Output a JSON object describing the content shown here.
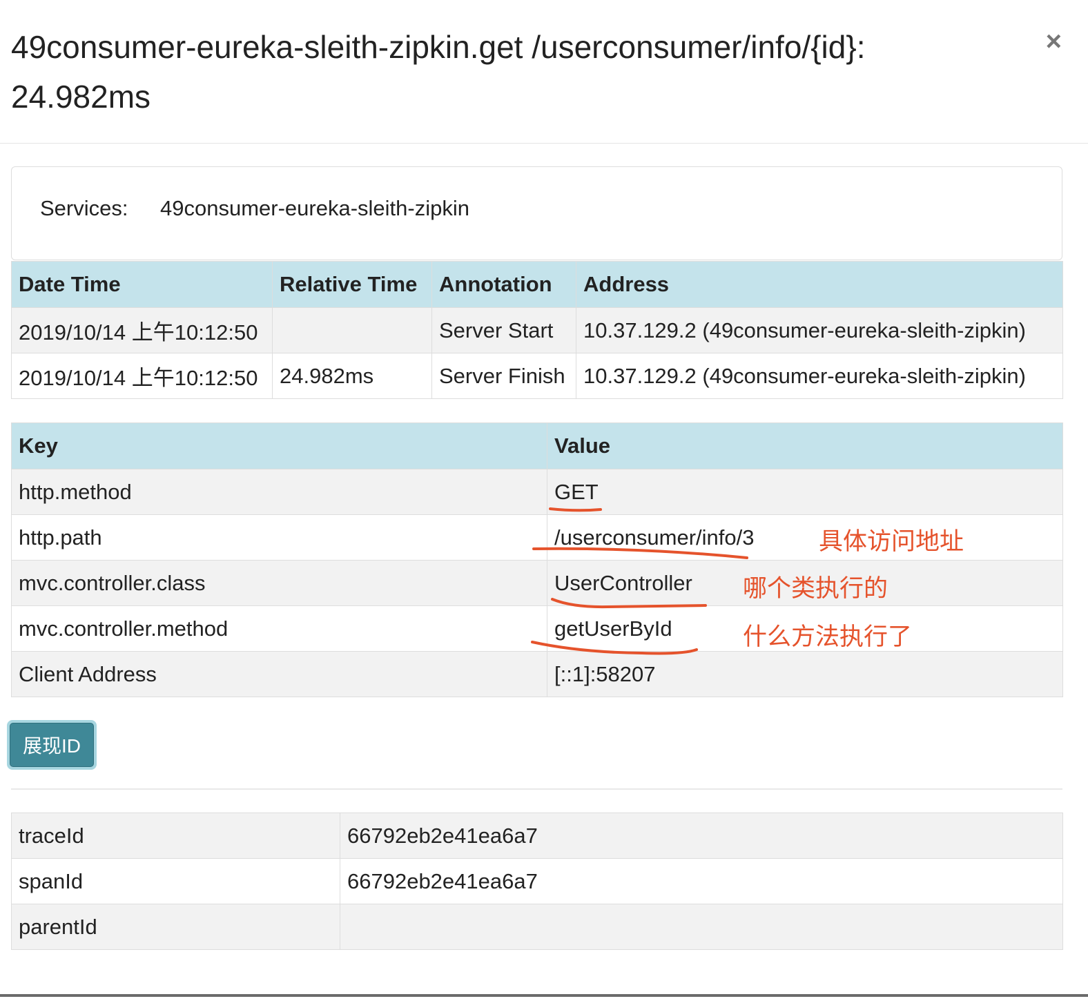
{
  "modal": {
    "title": "49consumer-eureka-sleith-zipkin.get /userconsumer/info/{id}: 24.982ms",
    "close_label": "×"
  },
  "services": {
    "label": "Services:",
    "value": "49consumer-eureka-sleith-zipkin"
  },
  "annotations": {
    "headers": [
      "Date Time",
      "Relative Time",
      "Annotation",
      "Address"
    ],
    "rows": [
      {
        "date_time": "2019/10/14 上午10:12:50",
        "relative_time": "",
        "annotation": "Server Start",
        "address": "10.37.129.2 (49consumer-eureka-sleith-zipkin)"
      },
      {
        "date_time": "2019/10/14 上午10:12:50",
        "relative_time": "24.982ms",
        "annotation": "Server Finish",
        "address": "10.37.129.2 (49consumer-eureka-sleith-zipkin)"
      }
    ]
  },
  "tags": {
    "headers": [
      "Key",
      "Value"
    ],
    "rows": [
      {
        "key": "http.method",
        "value": "GET"
      },
      {
        "key": "http.path",
        "value": "/userconsumer/info/3"
      },
      {
        "key": "mvc.controller.class",
        "value": "UserController"
      },
      {
        "key": "mvc.controller.method",
        "value": "getUserById"
      },
      {
        "key": "Client Address",
        "value": "[::1]:58207"
      }
    ]
  },
  "toggle_button": {
    "label": "展现ID"
  },
  "ids": {
    "rows": [
      {
        "key": "traceId",
        "value": "66792eb2e41ea6a7"
      },
      {
        "key": "spanId",
        "value": "66792eb2e41ea6a7"
      },
      {
        "key": "parentId",
        "value": ""
      }
    ]
  },
  "notes": {
    "path": "具体访问地址",
    "class": "哪个类执行的",
    "method": "什么方法执行了"
  },
  "colors": {
    "header_bg": "#c4e3eb",
    "button_bg": "#3f8897",
    "annotation_red": "#e5532c"
  }
}
